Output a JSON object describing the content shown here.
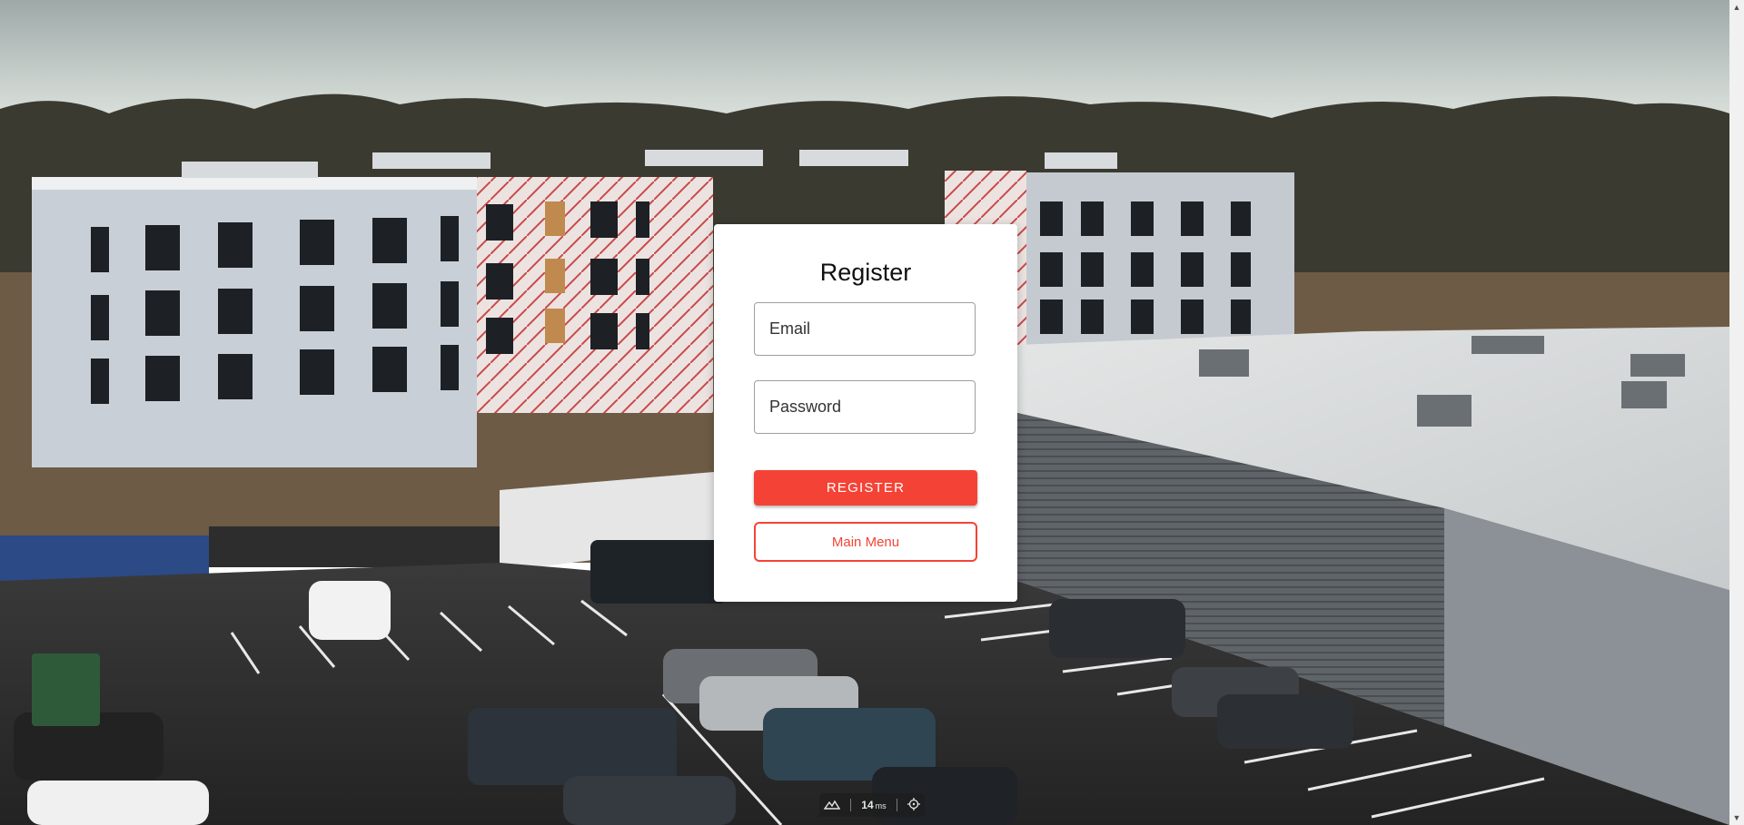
{
  "register_card": {
    "title": "Register",
    "email_placeholder": "Email",
    "password_placeholder": "Password",
    "register_button": "REGISTER",
    "main_menu_button": "Main Menu"
  },
  "stats_overlay": {
    "frame_time_value": "14",
    "frame_time_unit": "ms",
    "icons": [
      "mountain-icon",
      "target-icon"
    ]
  },
  "colors": {
    "accent": "#f44336",
    "card_background": "#ffffff"
  }
}
